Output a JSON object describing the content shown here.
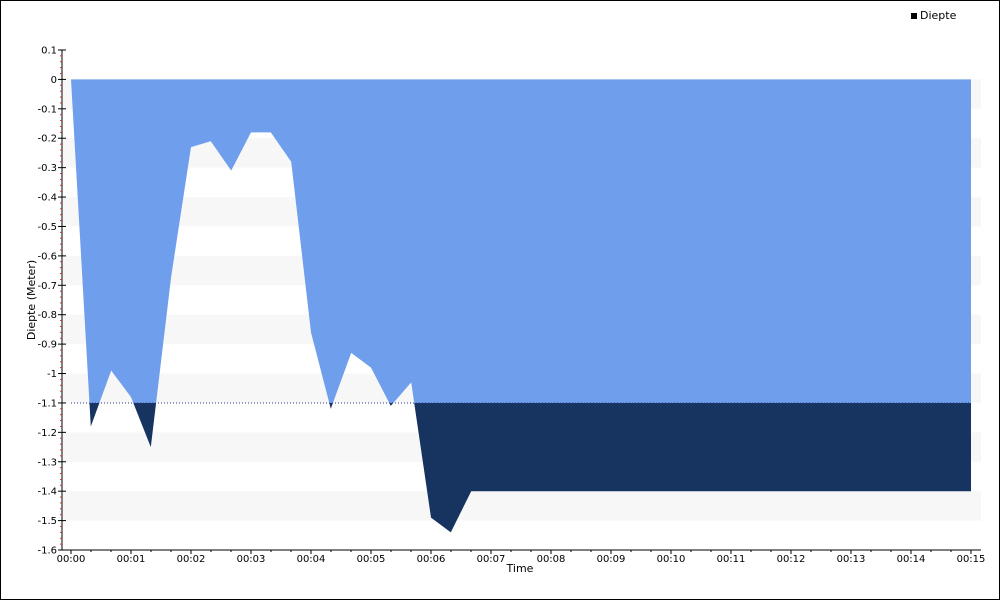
{
  "chart_data": {
    "type": "area",
    "title": "",
    "xlabel": "Time",
    "ylabel": "Diepte (Meter)",
    "legend": {
      "placement": "top-right",
      "entries": [
        "Diepte"
      ]
    },
    "ylim": [
      -1.6,
      0.1
    ],
    "yticks": [
      0.1,
      0,
      -0.1,
      -0.2,
      -0.3,
      -0.4,
      -0.5,
      -0.6,
      -0.7,
      -0.8,
      -0.9,
      -1,
      -1.1,
      -1.2,
      -1.3,
      -1.4,
      -1.5,
      -1.6
    ],
    "ytick_labels": [
      "0.1",
      "0",
      "-0.1",
      "-0.2",
      "-0.3",
      "-0.4",
      "-0.5",
      "-0.6",
      "-0.7",
      "-0.8",
      "-0.9",
      "-1",
      "-1.1",
      "-1.2",
      "-1.3",
      "-1.4",
      "-1.5",
      "-1.6"
    ],
    "xlim_minutes": [
      0,
      15
    ],
    "xtick_labels": [
      "00:00",
      "00:01",
      "00:02",
      "00:03",
      "00:04",
      "00:05",
      "00:06",
      "00:07",
      "00:08",
      "00:09",
      "00:10",
      "00:11",
      "00:12",
      "00:13",
      "00:14",
      "00:15"
    ],
    "threshold": -1.1,
    "grid": "alternating horizontal bands",
    "series": [
      {
        "name": "Diepte",
        "x_minutes": [
          0,
          0.33,
          0.67,
          1.0,
          1.33,
          1.67,
          2.0,
          2.33,
          2.67,
          3.0,
          3.33,
          3.67,
          4.0,
          4.33,
          4.67,
          5.0,
          5.33,
          5.67,
          6.0,
          6.33,
          6.67,
          15.0
        ],
        "y": [
          0,
          -1.18,
          -0.99,
          -1.08,
          -1.25,
          -0.67,
          -0.23,
          -0.21,
          -0.31,
          -0.18,
          -0.18,
          -0.28,
          -0.86,
          -1.12,
          -0.93,
          -0.98,
          -1.11,
          -1.03,
          -1.49,
          -1.54,
          -1.4,
          -1.4
        ]
      }
    ],
    "colors": {
      "surface_fill": "#6f9fec",
      "deep_fill": "#173360",
      "band": "#f7f7f7",
      "threshold_line": "#2a3a8c",
      "axis_tick": "#cc3333"
    }
  }
}
